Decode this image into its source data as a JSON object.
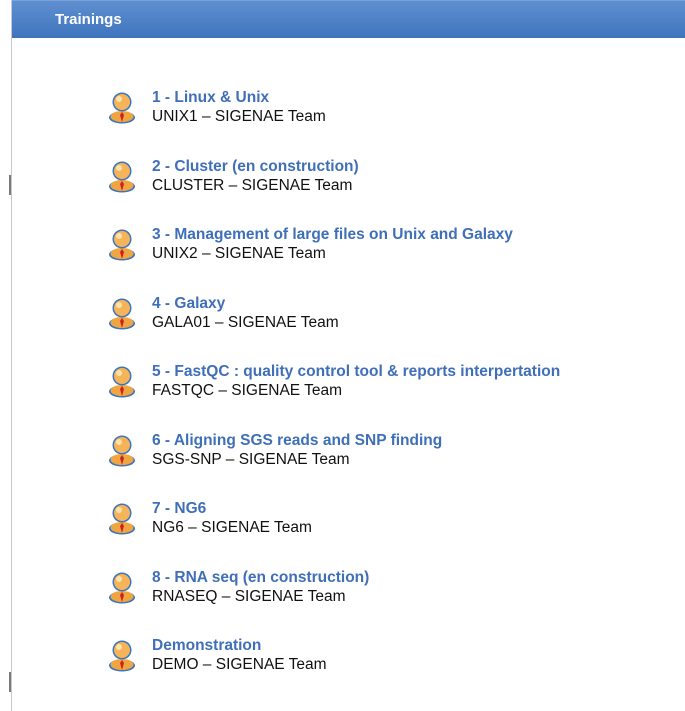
{
  "header": {
    "title": "Trainings"
  },
  "trainings": [
    {
      "title": "1 - Linux & Unix",
      "subtitle": "UNIX1 – SIGENAE Team",
      "icon": "user-icon"
    },
    {
      "title": "2 - Cluster (en construction)",
      "subtitle": "CLUSTER – SIGENAE Team",
      "icon": "user-icon"
    },
    {
      "title": "3 - Management of large files on Unix and Galaxy",
      "subtitle": "UNIX2 – SIGENAE Team",
      "icon": "user-icon"
    },
    {
      "title": "4 - Galaxy",
      "subtitle": "GALA01 – SIGENAE Team",
      "icon": "user-icon"
    },
    {
      "title": "5 - FastQC : quality control tool & reports interpertation",
      "subtitle": "FASTQC – SIGENAE Team",
      "icon": "user-icon"
    },
    {
      "title": "6 - Aligning SGS reads and SNP finding",
      "subtitle": "SGS-SNP – SIGENAE Team",
      "icon": "user-icon"
    },
    {
      "title": "7 - NG6",
      "subtitle": "NG6 – SIGENAE Team",
      "icon": "user-icon"
    },
    {
      "title": "8 - RNA seq (en construction)",
      "subtitle": "RNASEQ – SIGENAE Team",
      "icon": "user-icon"
    },
    {
      "title": "Demonstration",
      "subtitle": "DEMO – SIGENAE Team",
      "icon": "user-icon"
    }
  ],
  "colors": {
    "header_bg": "#4a7cc2",
    "link": "#3f6fb8",
    "text": "#111111",
    "icon_orange": "#f0a640",
    "icon_red": "#d02020"
  }
}
